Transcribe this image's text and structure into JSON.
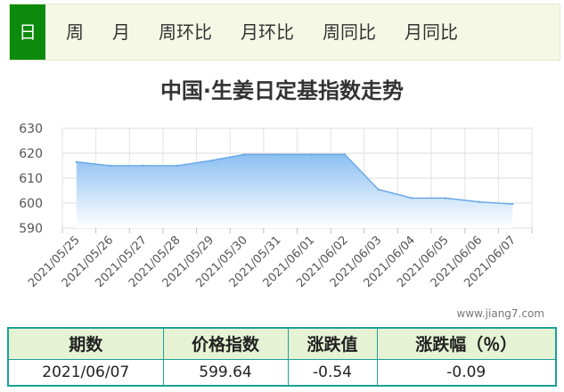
{
  "tabs": [
    {
      "label": "日",
      "active": true
    },
    {
      "label": "周",
      "active": false
    },
    {
      "label": "月",
      "active": false
    },
    {
      "label": "周环比",
      "active": false
    },
    {
      "label": "月环比",
      "active": false
    },
    {
      "label": "周同比",
      "active": false
    },
    {
      "label": "月同比",
      "active": false
    }
  ],
  "chart_data": {
    "type": "area",
    "title": "中国·生姜日定基指数走势",
    "x": [
      "2021/05/25",
      "2021/05/26",
      "2021/05/27",
      "2021/05/28",
      "2021/05/29",
      "2021/05/30",
      "2021/05/31",
      "2021/06/01",
      "2021/06/02",
      "2021/06/03",
      "2021/06/04",
      "2021/06/05",
      "2021/06/06",
      "2021/06/07"
    ],
    "values": [
      616.5,
      615,
      615,
      615,
      617,
      619.5,
      619.5,
      619.5,
      619.5,
      605.5,
      602,
      602,
      600.5,
      599.64
    ],
    "ylim": [
      590,
      630
    ],
    "yticks": [
      590,
      600,
      610,
      620,
      630
    ],
    "grid": true,
    "colors": {
      "line": "#6aa8e6",
      "fill_top": "#8cc0f2",
      "fill_bottom": "#ffffff"
    }
  },
  "watermark": "www.jiang7.com",
  "summary": {
    "headers": [
      "期数",
      "价格指数",
      "涨跌值",
      "涨跌幅（％）"
    ],
    "row": [
      "2021/06/07",
      "599.64",
      "-0.54",
      "-0.09"
    ]
  }
}
